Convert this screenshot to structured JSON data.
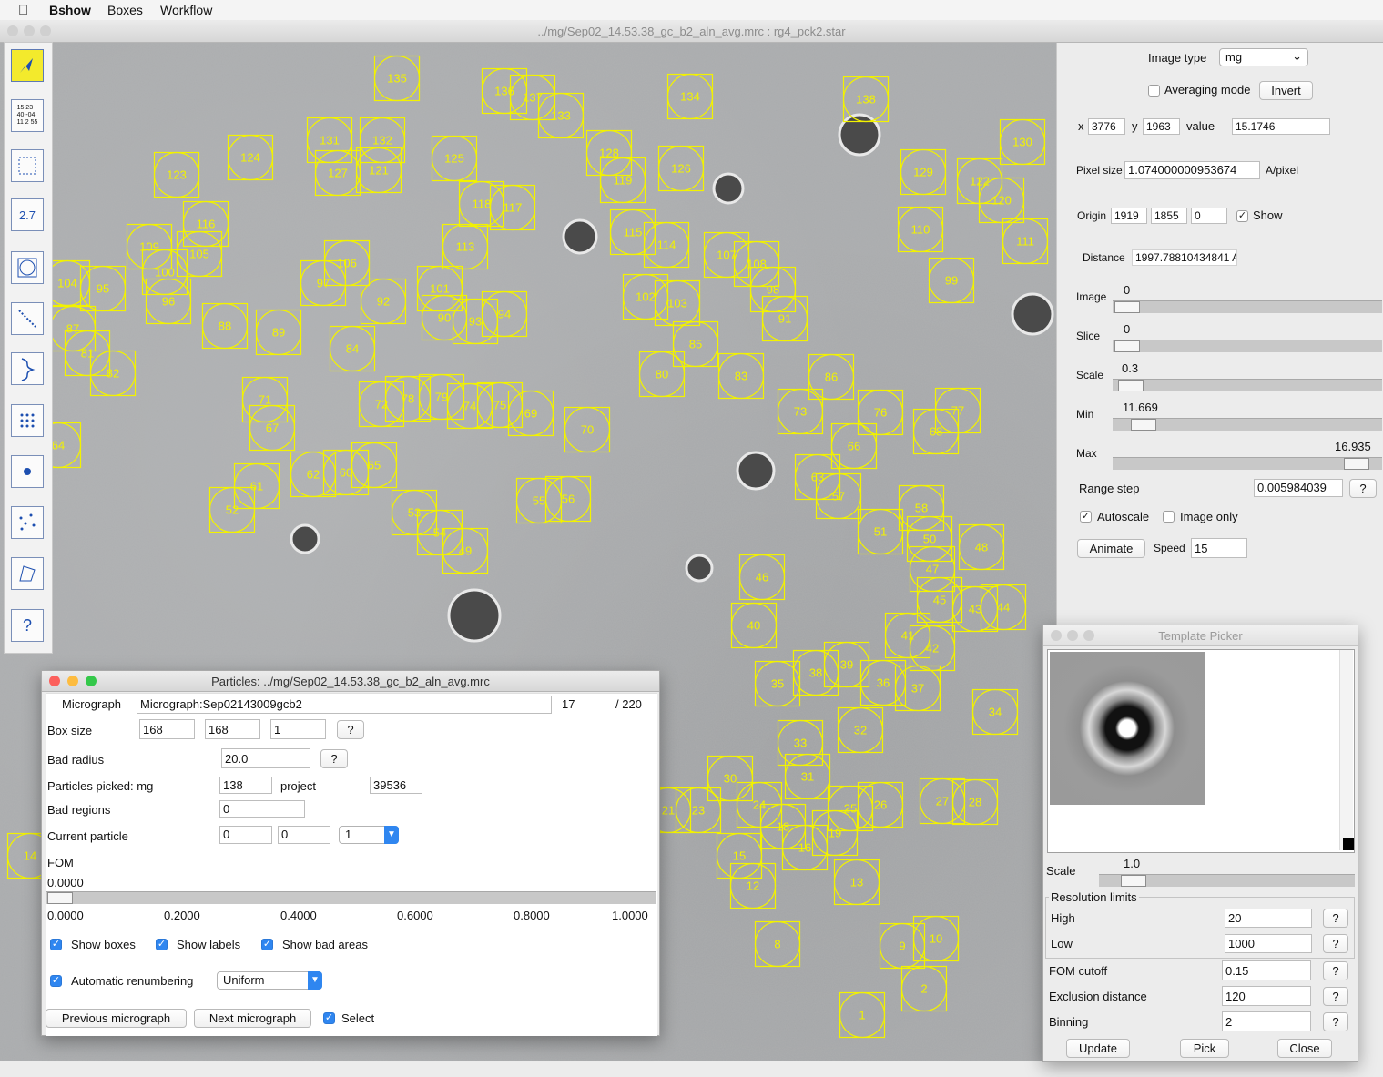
{
  "menubar": {
    "app": "Bshow",
    "menus": [
      "Boxes",
      "Workflow"
    ]
  },
  "main_window": {
    "title": "../mg/Sep02_14.53.38_gc_b2_aln_avg.mrc : rg4_pck2.star"
  },
  "toolbar": {
    "numbers_icon_text": "15 23\n40 -04\n11 2 55",
    "measure_icon_text": "2.7",
    "help_icon_text": "?"
  },
  "right_panel": {
    "image_type_label": "Image type",
    "image_type_value": "mg",
    "averaging_mode_label": "Averaging mode",
    "invert_label": "Invert",
    "x_label": "x",
    "x_value": "3776",
    "y_label": "y",
    "y_value": "1963",
    "value_label": "value",
    "value_value": "15.1746",
    "pixel_size_label": "Pixel size",
    "pixel_size_value": "1.074000000953674",
    "pixel_size_unit": "A/pixel",
    "origin_label": "Origin",
    "origin_x": "1919",
    "origin_y": "1855",
    "origin_z": "0",
    "show_label": "Show",
    "distance_label": "Distance",
    "distance_value": "1997.78810434841 A",
    "image_label": "Image",
    "image_value": "0",
    "slice_label": "Slice",
    "slice_value": "0",
    "scale_label": "Scale",
    "scale_value": "0.3",
    "min_label": "Min",
    "min_value": "11.669",
    "max_label": "Max",
    "max_value": "16.935",
    "range_step_label": "Range step",
    "range_step_value": "0.005984039",
    "help": "?",
    "autoscale_label": "Autoscale",
    "image_only_label": "Image only",
    "animate_label": "Animate",
    "speed_label": "Speed",
    "speed_value": "15"
  },
  "particles_dialog": {
    "title": "Particles: ../mg/Sep02_14.53.38_gc_b2_aln_avg.mrc",
    "micrograph_label": "Micrograph",
    "micrograph_value": "Micrograph:Sep02143009gcb2",
    "micrograph_index": "17",
    "micrograph_total": "/ 220",
    "box_size_label": "Box size",
    "box_x": "168",
    "box_y": "168",
    "box_z": "1",
    "help": "?",
    "bad_radius_label": "Bad radius",
    "bad_radius_value": "20.0",
    "picked_label": "Particles picked: mg",
    "picked_value": "138",
    "project_label": "project",
    "project_value": "39536",
    "bad_regions_label": "Bad regions",
    "bad_regions_value": "0",
    "current_label": "Current particle",
    "current_a": "0",
    "current_b": "0",
    "current_c": "1",
    "fom_label": "FOM",
    "fom_value": "0.0000",
    "fom_ticks": [
      "0.0000",
      "0.2000",
      "0.4000",
      "0.6000",
      "0.8000",
      "1.0000"
    ],
    "fom_fraction": 0.0,
    "show_boxes_label": "Show boxes",
    "show_labels_label": "Show labels",
    "show_bad_label": "Show bad areas",
    "auto_renum_label": "Automatic renumbering",
    "renum_mode": "Uniform",
    "prev_label": "Previous micrograph",
    "next_label": "Next micrograph",
    "select_label": "Select"
  },
  "template_picker": {
    "title": "Template Picker",
    "scale_label": "Scale",
    "scale_value": "1.0",
    "resolution_label": "Resolution limits",
    "high_label": "High",
    "high_value": "20",
    "low_label": "Low",
    "low_value": "1000",
    "fom_cutoff_label": "FOM cutoff",
    "fom_cutoff_value": "0.15",
    "exclusion_label": "Exclusion distance",
    "exclusion_value": "120",
    "binning_label": "Binning",
    "binning_value": "2",
    "update_label": "Update",
    "pick_label": "Pick",
    "close_label": "Close",
    "help": "?"
  },
  "colors": {
    "box": "#f2f200",
    "accent": "#2f86f0"
  },
  "particle_labels": [
    "135",
    "136",
    "137",
    "133",
    "134",
    "138",
    "131",
    "132",
    "127",
    "121",
    "123",
    "124",
    "125",
    "128",
    "119",
    "126",
    "129",
    "122",
    "130",
    "120",
    "118",
    "117",
    "116",
    "109",
    "105",
    "100",
    "104",
    "95",
    "96",
    "106",
    "97",
    "92",
    "101",
    "90",
    "93",
    "94",
    "113",
    "115",
    "114",
    "107",
    "108",
    "98",
    "91",
    "110",
    "111",
    "99",
    "87",
    "81",
    "82",
    "88",
    "89",
    "84",
    "102",
    "103",
    "85",
    "80",
    "83",
    "86",
    "73",
    "76",
    "68",
    "77",
    "71",
    "67",
    "72",
    "78",
    "79",
    "74",
    "75",
    "69",
    "70",
    "66",
    "63",
    "57",
    "64",
    "62",
    "60",
    "65",
    "61",
    "52",
    "55",
    "56",
    "58",
    "51",
    "50",
    "47",
    "48",
    "53",
    "54",
    "49",
    "46",
    "40",
    "45",
    "43",
    "44",
    "41",
    "42",
    "35",
    "38",
    "39",
    "36",
    "37",
    "34",
    "33",
    "32",
    "31",
    "30",
    "21",
    "23",
    "24",
    "25",
    "26",
    "27",
    "28",
    "18",
    "19",
    "16",
    "15",
    "12",
    "13",
    "8",
    "9",
    "10",
    "2",
    "1",
    "14"
  ]
}
